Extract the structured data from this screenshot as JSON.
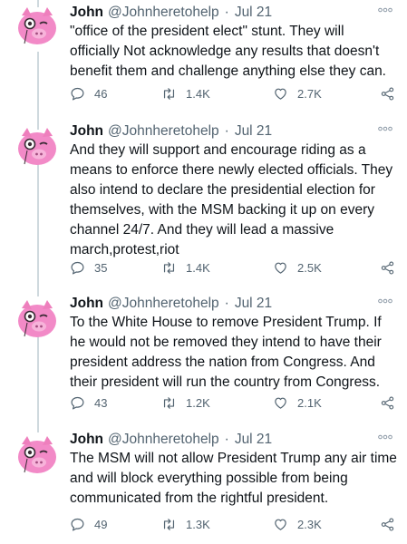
{
  "tweets": [
    {
      "name": "John",
      "handle": "@Johnheretohelp",
      "separator": "·",
      "date": "Jul 21",
      "text": "\"office of the president elect\" stunt. They will\nofficially Not acknowledge any results that doesn't\nbenefit them and challenge anything else they can.",
      "replies": "46",
      "retweets": "1.4K",
      "likes": "2.7K"
    },
    {
      "name": "John",
      "handle": "@Johnheretohelp",
      "separator": "·",
      "date": "Jul 21",
      "text": "And they will support and encourage riding as a\nmeans to enforce there newly elected officials. They\nalso intend to declare the presidential election for\nthemselves, with the MSM backing it up on every\nchannel 24/7. And they will lead a massive\nmarch,protest,riot",
      "replies": "35",
      "retweets": "1.4K",
      "likes": "2.5K"
    },
    {
      "name": "John",
      "handle": "@Johnheretohelp",
      "separator": "·",
      "date": "Jul 21",
      "text": "To the White House to remove President Trump. If\nhe would not be removed they intend to have their\npresident address the nation from Congress. And\ntheir president will run the country from Congress.",
      "replies": "43",
      "retweets": "1.2K",
      "likes": "2.1K"
    },
    {
      "name": "John",
      "handle": "@Johnheretohelp",
      "separator": "·",
      "date": "Jul 21",
      "text": "The MSM will not allow President Trump any air time\nand will block everything possible from being\ncommunicated from the rightful president.",
      "replies": "49",
      "retweets": "1.3K",
      "likes": "2.3K"
    }
  ],
  "icons": {
    "avatar": "pink-pig-monocle-icon",
    "more": "more-dots-icon",
    "reply": "reply-icon",
    "retweet": "retweet-icon",
    "like": "heart-icon",
    "share": "share-icon"
  },
  "colors": {
    "text": "#0f1419",
    "muted": "#536471",
    "thread_line": "#cfd9de",
    "avatar_pink": "#f28ac7"
  }
}
